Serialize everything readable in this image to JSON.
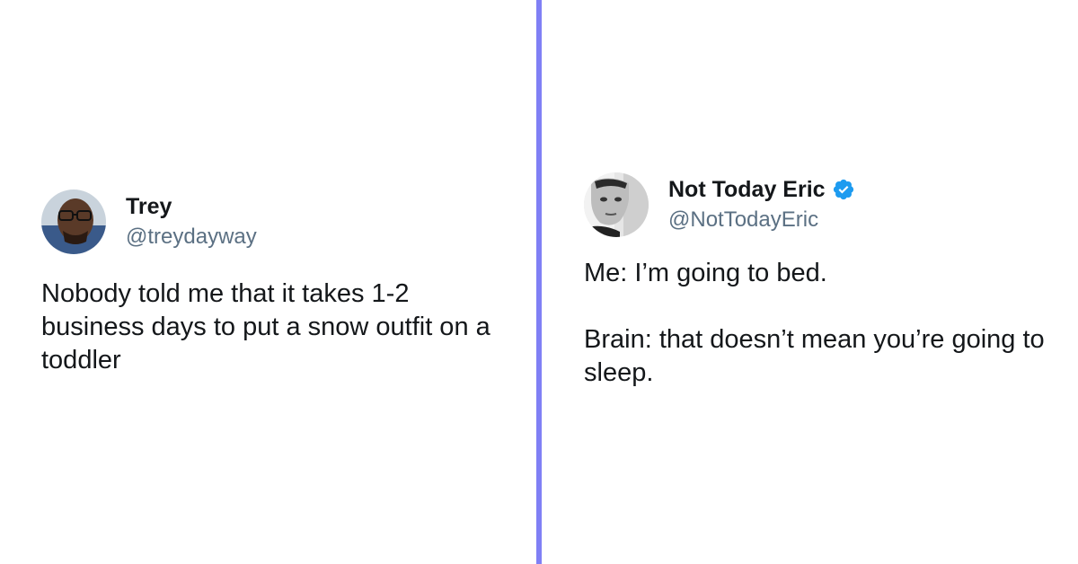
{
  "tweets": [
    {
      "display_name": "Trey",
      "handle": "@treydayway",
      "verified": false,
      "paragraphs": [
        "Nobody told me that it takes 1-2 business days to put a snow outfit on a toddler"
      ]
    },
    {
      "display_name": "Not Today Eric",
      "handle": "@NotTodayEric",
      "verified": true,
      "paragraphs": [
        "Me: I’m going to bed.",
        "Brain: that doesn’t mean you’re going to sleep."
      ]
    }
  ],
  "colors": {
    "divider": "#8080f5",
    "text": "#14171a",
    "handle": "#5b7083",
    "verified_badge": "#1d9bf0"
  },
  "icons": {
    "verified": "verified-badge-icon"
  }
}
